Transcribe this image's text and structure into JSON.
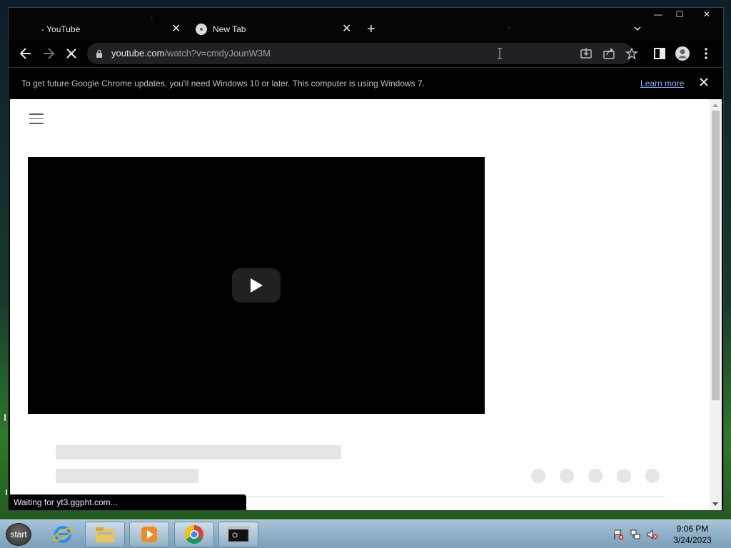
{
  "browser": {
    "tabs": [
      {
        "title": "- YouTube",
        "close_label": "✕"
      },
      {
        "title": "New Tab",
        "close_label": "✕"
      }
    ],
    "new_tab_label": "+",
    "window_controls": {
      "minimize": "—",
      "maximize": "☐",
      "close": "✕"
    },
    "address": {
      "host": "youtube.com",
      "path": "/watch?v=cmdyJounW3M"
    },
    "infobar": {
      "message": "To get future Google Chrome updates, you'll need Windows 10 or later. This computer is using Windows 7.",
      "link": "Learn more"
    },
    "status": "Waiting for yt3.ggpht.com..."
  },
  "taskbar": {
    "start_label": "start",
    "clock": {
      "time": "9:06 PM",
      "date": "3/24/2023"
    }
  }
}
